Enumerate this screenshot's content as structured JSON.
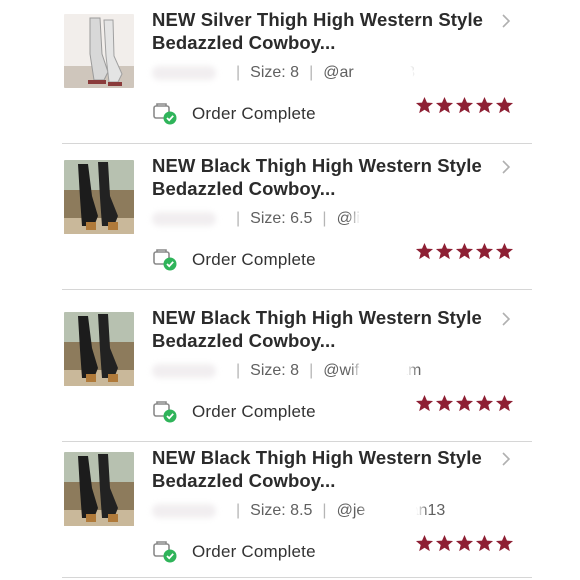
{
  "orders": [
    {
      "title_line1": "NEW Silver Thigh High Western Style",
      "title_line2": "Bedazzled Cowboy...",
      "size": "Size: 8",
      "handle": "@ar        s13",
      "status": "Order Complete",
      "rating": 5,
      "boot_color": "#d7d7d7",
      "bg_top": "#f4f1ee",
      "bg_bottom": "#e2dcd4"
    },
    {
      "title_line1": "NEW Black Thigh High Western Style",
      "title_line2": "Bedazzled Cowboy...",
      "size": "Size: 6.5",
      "handle": "@li",
      "status": "Order Complete",
      "rating": 5,
      "boot_color": "#1c1c1c",
      "bg_top": "#b9c3b2",
      "bg_bottom": "#8f7d5f"
    },
    {
      "title_line1": "NEW Black Thigh High Western Style",
      "title_line2": "Bedazzled Cowboy...",
      "size": "Size: 8",
      "handle": "@wif         am",
      "status": "Order Complete",
      "rating": 5,
      "boot_color": "#1c1c1c",
      "bg_top": "#b9c3b2",
      "bg_bottom": "#8f7d5f"
    },
    {
      "title_line1": "NEW Black Thigh High Western Style",
      "title_line2": "Bedazzled Cowboy...",
      "size": "Size: 8.5",
      "handle": "@je          an13",
      "status": "Order Complete",
      "rating": 5,
      "boot_color": "#1c1c1c",
      "bg_top": "#b9c3b2",
      "bg_bottom": "#8f7d5f"
    }
  ],
  "colors": {
    "star": "#8e2034",
    "check": "#2fb45a",
    "chevron": "#b0b0b0"
  }
}
